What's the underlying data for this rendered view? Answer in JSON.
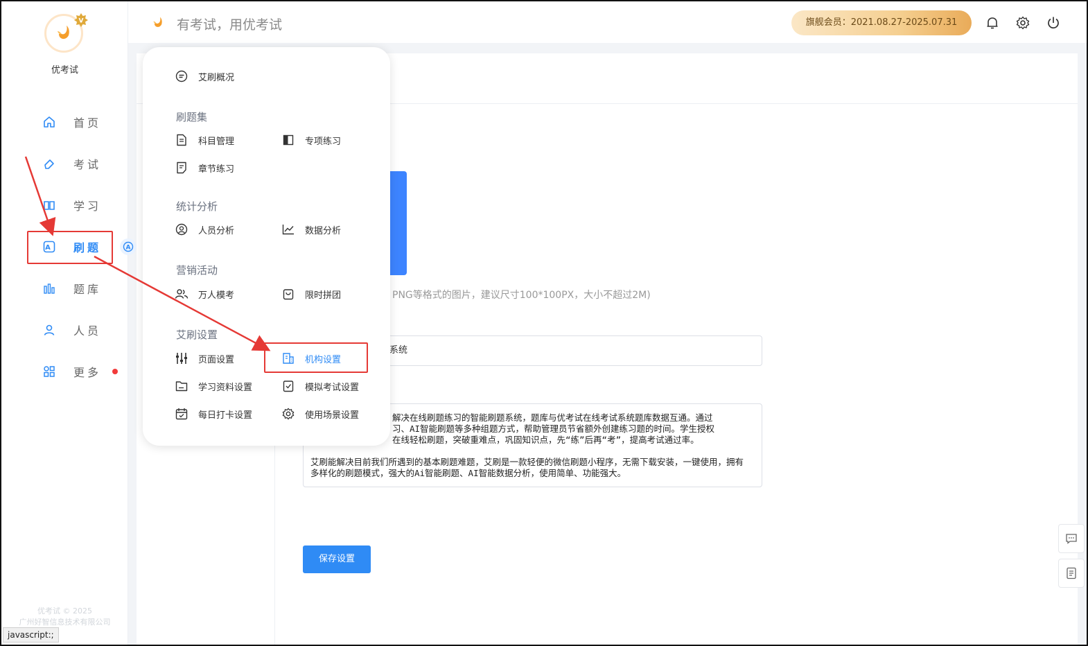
{
  "brand": {
    "name": "优考试",
    "slogan": "有考试，用优考试",
    "badge_letter": "V",
    "accent": "#2f8bf5"
  },
  "sidebar": {
    "items": [
      {
        "label": "首页",
        "icon": "home-icon"
      },
      {
        "label": "考试",
        "icon": "eraser-icon"
      },
      {
        "label": "学习",
        "icon": "book-icon"
      },
      {
        "label": "刷题",
        "icon": "a-badge-icon",
        "active": true
      },
      {
        "label": "题库",
        "icon": "bars-icon"
      },
      {
        "label": "人员",
        "icon": "user-icon"
      },
      {
        "label": "更多",
        "icon": "apps-icon",
        "has_dot": true
      }
    ],
    "copyright_line1": "优考试 © 2025",
    "copyright_line2": "广州好智信息技术有限公司"
  },
  "statusbar": {
    "url": "javascript:;"
  },
  "header": {
    "vip_label": "旗舰会员：2021.08.27-2025.07.31",
    "icons": [
      "bell-icon",
      "gear-icon",
      "power-icon"
    ]
  },
  "popup": {
    "overview": "艾刷概况",
    "sections": [
      {
        "title": "刷题集",
        "items": [
          {
            "label": "科目管理",
            "icon": "doc-icon"
          },
          {
            "label": "专项练习",
            "icon": "half-square-icon"
          },
          {
            "label": "章节练习",
            "icon": "chapter-icon"
          }
        ]
      },
      {
        "title": "统计分析",
        "items": [
          {
            "label": "人员分析",
            "icon": "user-circle-icon"
          },
          {
            "label": "数据分析",
            "icon": "trend-icon"
          }
        ]
      },
      {
        "title": "营销活动",
        "items": [
          {
            "label": "万人模考",
            "icon": "group-icon"
          },
          {
            "label": "限时拼团",
            "icon": "bag-icon"
          }
        ]
      },
      {
        "title": "艾刷设置",
        "items": [
          {
            "label": "页面设置",
            "icon": "sliders-icon"
          },
          {
            "label": "机构设置",
            "icon": "org-icon",
            "active": true
          },
          {
            "label": "学习资料设置",
            "icon": "folder-icon"
          },
          {
            "label": "模拟考试设置",
            "icon": "check-doc-icon"
          },
          {
            "label": "每日打卡设置",
            "icon": "calendar-icon"
          },
          {
            "label": "使用场景设置",
            "icon": "cog-icon"
          }
        ]
      }
    ]
  },
  "form": {
    "logo_hint": "PNG等格式的图片，建议尺寸100*100PX，大小不超过2M)",
    "name_value_partial": "系统",
    "desc_para1_line1": "解决在线刷题练习的智能刷题系统，题库与优考试在线考试系统题库数据互通。通过",
    "desc_para1_line2": "习、AI智能刷题等多种组题方式，帮助管理员节省额外创建练习题的时间。学生授权",
    "desc_para1_line3": "在线轻松刷题，突破重难点，巩固知识点，先“练”后再“考”，提高考试通过率。",
    "desc_para2": "艾刷能解决目前我们所遇到的基本刷题难题，艾刷是一款轻便的微信刷题小程序，无需下载安装，一键使用，拥有多样化的刷题模式，强大的Ai智能刷题、AI智能数据分析，使用简单、功能强大。",
    "save_label": "保存设置"
  },
  "float_buttons": [
    "chat-icon",
    "note-icon"
  ]
}
